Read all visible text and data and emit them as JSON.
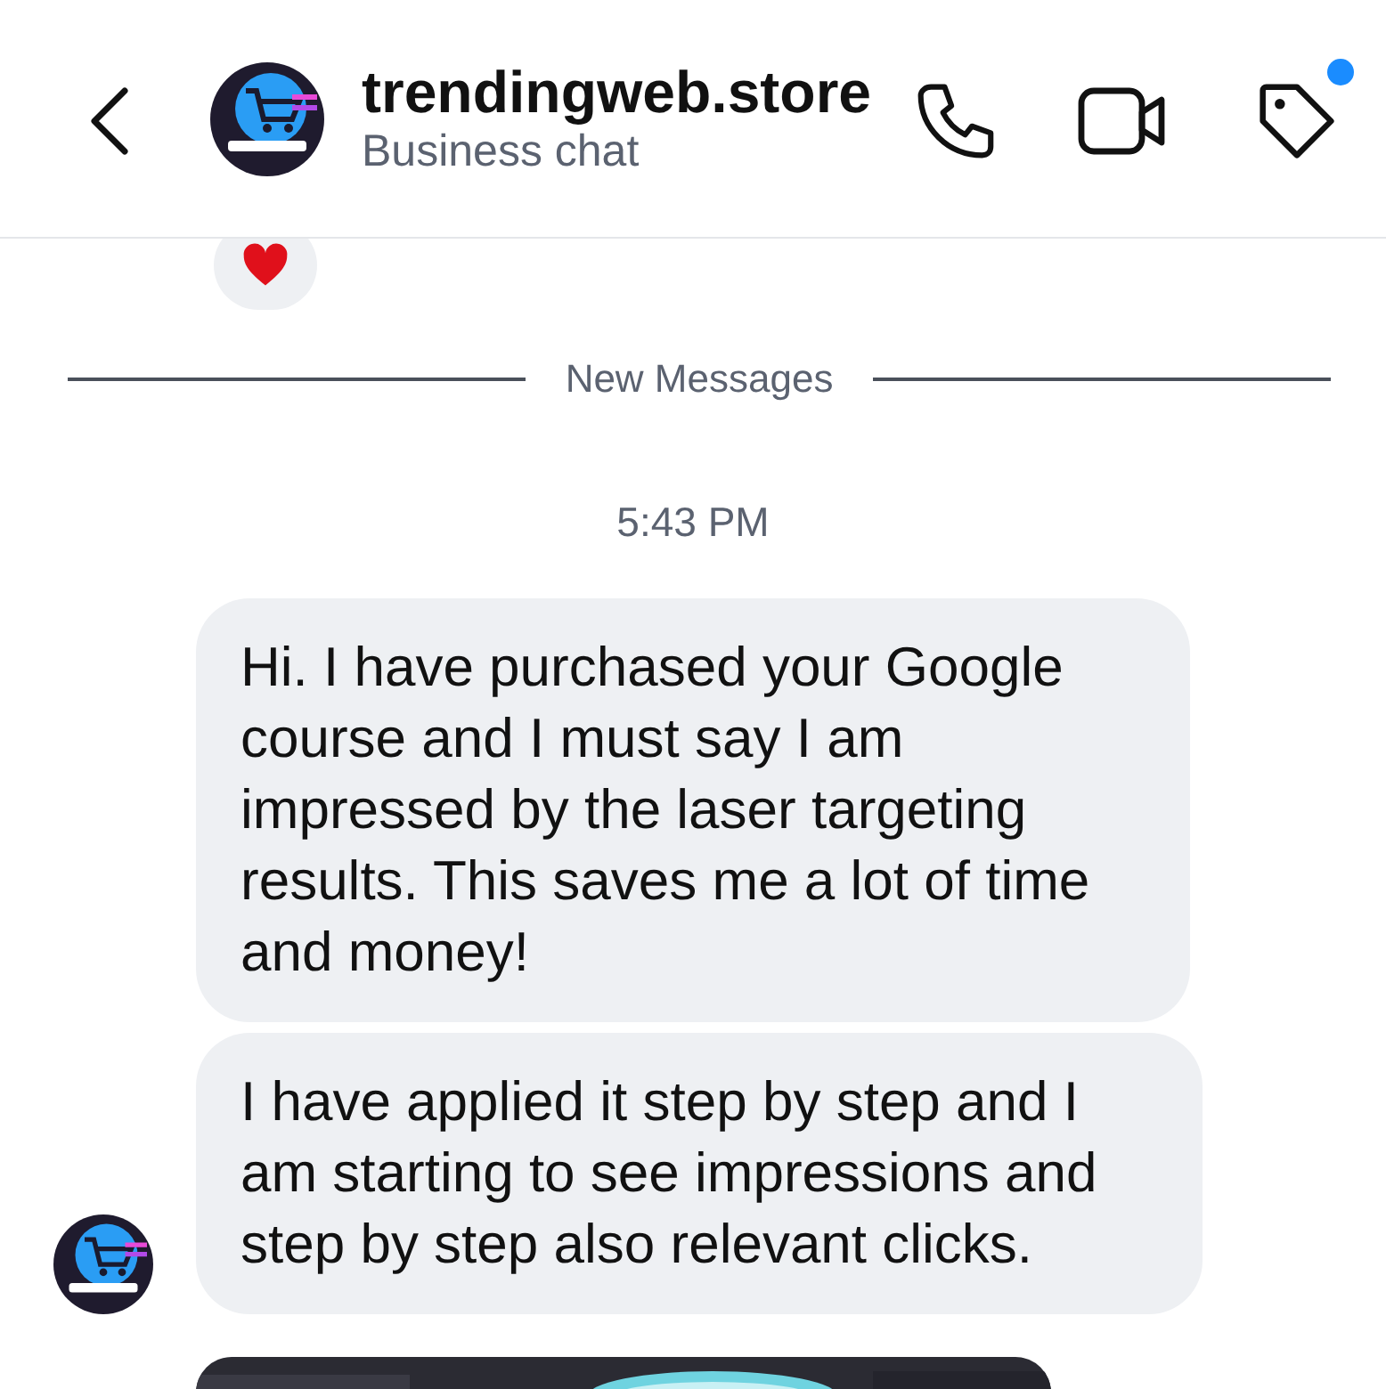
{
  "header": {
    "title": "trendingweb.store",
    "subtitle": "Business chat",
    "tag_has_badge": true
  },
  "divider": {
    "label": "New Messages"
  },
  "timestamp": "5:43 PM",
  "messages": [
    {
      "text": "Hi. I have purchased your Google course and I must say I am impressed by the laser targeting results. This saves me a lot of time and money!",
      "show_avatar": false
    },
    {
      "text": "I have applied it step by step and I am starting to see impressions and step by step also relevant clicks.",
      "show_avatar": true
    },
    {
      "kind": "picture",
      "show_avatar": false
    }
  ]
}
